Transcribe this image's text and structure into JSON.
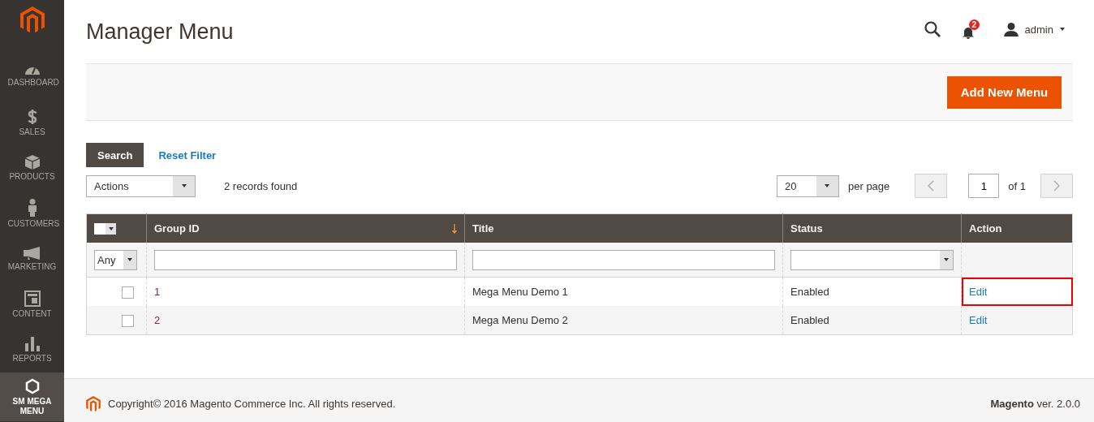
{
  "sidebar": {
    "items": [
      {
        "label": "DASHBOARD",
        "kind": "gauge",
        "selected": false
      },
      {
        "label": "SALES",
        "kind": "dollar",
        "selected": false
      },
      {
        "label": "PRODUCTS",
        "kind": "box",
        "selected": false
      },
      {
        "label": "CUSTOMERS",
        "kind": "person",
        "selected": false
      },
      {
        "label": "MARKETING",
        "kind": "megaphone",
        "selected": false
      },
      {
        "label": "CONTENT",
        "kind": "layout",
        "selected": false
      },
      {
        "label": "REPORTS",
        "kind": "bars",
        "selected": false
      },
      {
        "label": "SM MEGA MENU",
        "kind": "hexagon",
        "selected": true
      }
    ]
  },
  "header": {
    "page_title": "Manager Menu",
    "notifications": "2",
    "user": "admin"
  },
  "action_bar": {
    "primary_button": "Add New Menu"
  },
  "grid": {
    "search_button": "Search",
    "reset_link": "Reset Filter",
    "mass_actions": {
      "value": "Actions"
    },
    "records": "2 records found",
    "per_page": {
      "value": "20"
    },
    "per_page_label": "per page",
    "page": {
      "value": "1"
    },
    "page_total": "of 1",
    "columns": [
      {
        "label": "Group ID",
        "sorted": true
      },
      {
        "label": "Title",
        "sorted": false
      },
      {
        "label": "Status",
        "sorted": false
      },
      {
        "label": "Action",
        "sorted": false
      }
    ],
    "filter_any": {
      "value": "Any"
    },
    "mass_select": {
      "checked": false
    },
    "rows": [
      {
        "group_id": "1",
        "title": "Mega Menu Demo 1",
        "status": "Enabled",
        "action": "Edit",
        "checked": false,
        "highlighted": true
      },
      {
        "group_id": "2",
        "title": "Mega Menu Demo 2",
        "status": "Enabled",
        "action": "Edit",
        "checked": false,
        "highlighted": false
      }
    ]
  },
  "footer": {
    "copyright": "Copyright© 2016 Magento Commerce Inc. All rights reserved.",
    "version": "**Magento** ver. 2.0.0"
  }
}
